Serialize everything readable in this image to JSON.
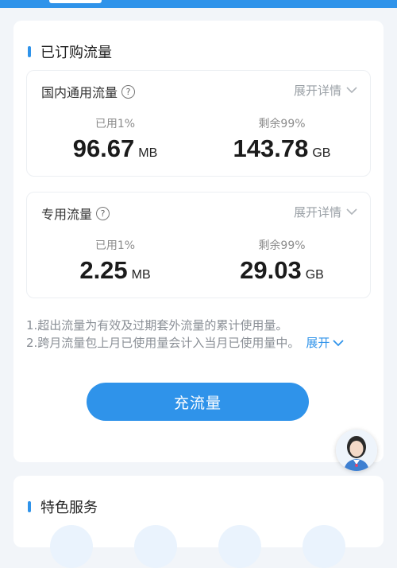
{
  "purchased": {
    "title": "已订购流量",
    "cards": [
      {
        "label": "国内通用流量",
        "expand": "展开详情",
        "used_label": "已用1%",
        "used_value": "96.67",
        "used_unit": "MB",
        "remain_label": "剩余99%",
        "remain_value": "143.78",
        "remain_unit": "GB"
      },
      {
        "label": "专用流量",
        "expand": "展开详情",
        "used_label": "已用1%",
        "used_value": "2.25",
        "used_unit": "MB",
        "remain_label": "剩余99%",
        "remain_value": "29.03",
        "remain_unit": "GB"
      }
    ],
    "notes": [
      "1.超出流量为有效及过期套外流量的累计使用量。",
      "2.跨月流量包上月已使用量会计入当月已使用量中。"
    ],
    "notes_expand": "展开",
    "recharge_label": "充流量"
  },
  "services": {
    "title": "特色服务"
  },
  "icons": {
    "help": "help-circle-icon",
    "chevron": "chevron-down-icon"
  },
  "colors": {
    "accent": "#2f93ea",
    "muted": "#8a8f96"
  }
}
